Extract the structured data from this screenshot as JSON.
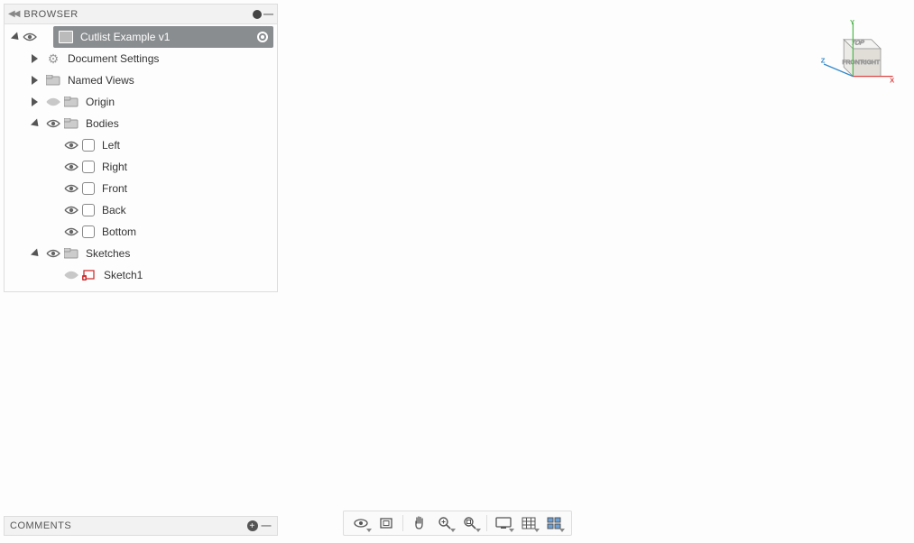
{
  "browser": {
    "header": "BROWSER",
    "root": "Cutlist Example v1",
    "items": {
      "docSettings": "Document Settings",
      "namedViews": "Named Views",
      "origin": "Origin",
      "bodies": "Bodies",
      "sketches": "Sketches",
      "sketch1": "Sketch1"
    },
    "bodies": [
      "Left",
      "Right",
      "Front",
      "Back",
      "Bottom"
    ]
  },
  "comments": {
    "header": "COMMENTS"
  },
  "viewcube": {
    "top": "TOP",
    "front": "FRONT",
    "right": "RIGHT",
    "axes": [
      "X",
      "Y",
      "Z"
    ]
  },
  "navbar": {
    "orbit": "Orbit",
    "lookat": "Look At",
    "pan": "Pan",
    "zoom": "Zoom",
    "fit": "Fit",
    "display": "Display Settings",
    "grid": "Grid",
    "viewports": "Viewports"
  }
}
